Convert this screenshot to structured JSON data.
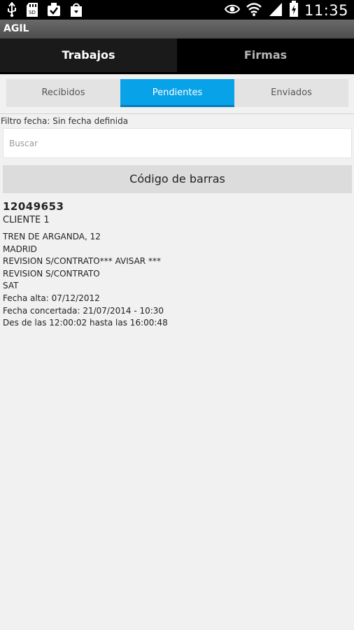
{
  "status_bar": {
    "time": "11:35",
    "left_icons": [
      "usb-icon",
      "sd-card-icon",
      "download-icon",
      "shopping-bag-icon"
    ],
    "right_icons": [
      "eye-icon",
      "wifi-icon",
      "signal-icon",
      "battery-charging-icon"
    ]
  },
  "app": {
    "title": "AGIL"
  },
  "main_tabs": [
    {
      "label": "Trabajos",
      "active": true
    },
    {
      "label": "Firmas",
      "active": false
    }
  ],
  "sub_tabs": [
    {
      "label": "Recibidos",
      "active": false
    },
    {
      "label": "Pendientes",
      "active": true
    },
    {
      "label": "Enviados",
      "active": false
    }
  ],
  "filter": {
    "text": "Filtro fecha: Sin fecha definida"
  },
  "search": {
    "placeholder": "Buscar",
    "value": ""
  },
  "barcode_button": {
    "label": "Código de barras"
  },
  "job": {
    "id": "12049653",
    "client": "CLIENTE 1",
    "lines": [
      "TREN DE ARGANDA, 12",
      "MADRID",
      "REVISION S/CONTRATO*** AVISAR ***",
      "REVISION S/CONTRATO",
      "SAT",
      "Fecha alta: 07/12/2012",
      "Fecha concertada: 21/07/2014 - 10:30",
      "Des de las 12:00:02 hasta las 16:00:48"
    ]
  },
  "colors": {
    "accent": "#08a2e8",
    "tab_active_bg": "#1a1a1a",
    "background": "#f1f1f1"
  }
}
